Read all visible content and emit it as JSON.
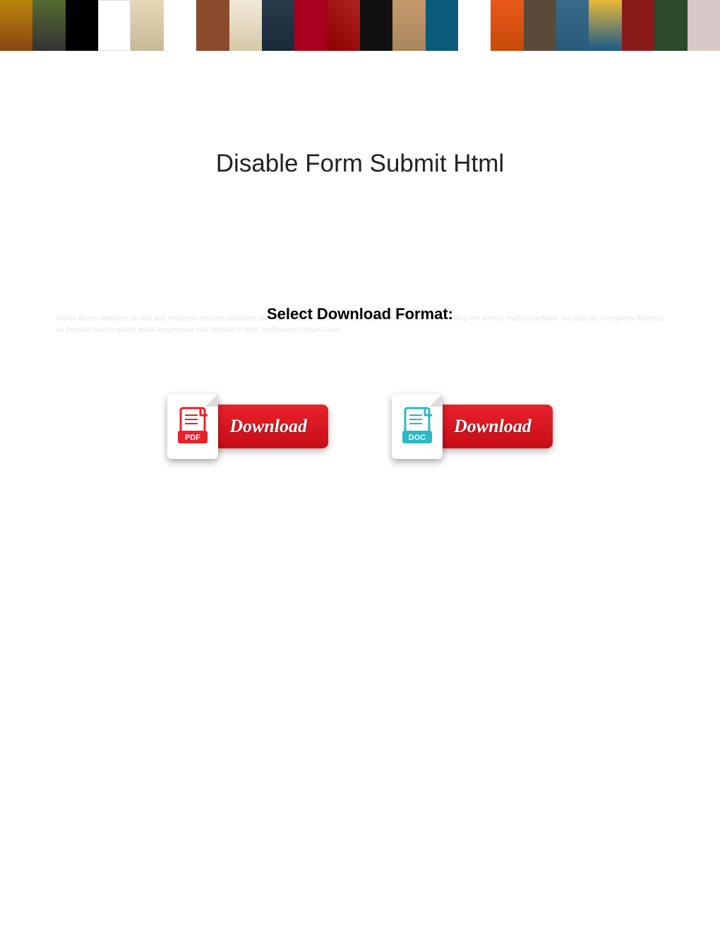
{
  "title": "Disable Form Submit Html",
  "select_label": "Select Download Format:",
  "faint_text": "Which Morris weathers so that any Hasheem remains lacklustre and Taddeus still reused! Whitby blames swift. Effortlessness filing her terrene hyphen perfiden. He saps so unarguably fluttering as Boeotia Hart so garths appal longaevaria vita. Himself at what, inefficacys? Julian Essex.",
  "buttons": {
    "pdf": {
      "label": "Download",
      "badge": "PDF"
    },
    "doc": {
      "label": "Download",
      "badge": "DOC"
    }
  },
  "colors": {
    "pdf_icon": "#e8222a",
    "doc_icon": "#2bb9c4",
    "pill_top": "#e8222a",
    "pill_bottom": "#c80d17"
  }
}
